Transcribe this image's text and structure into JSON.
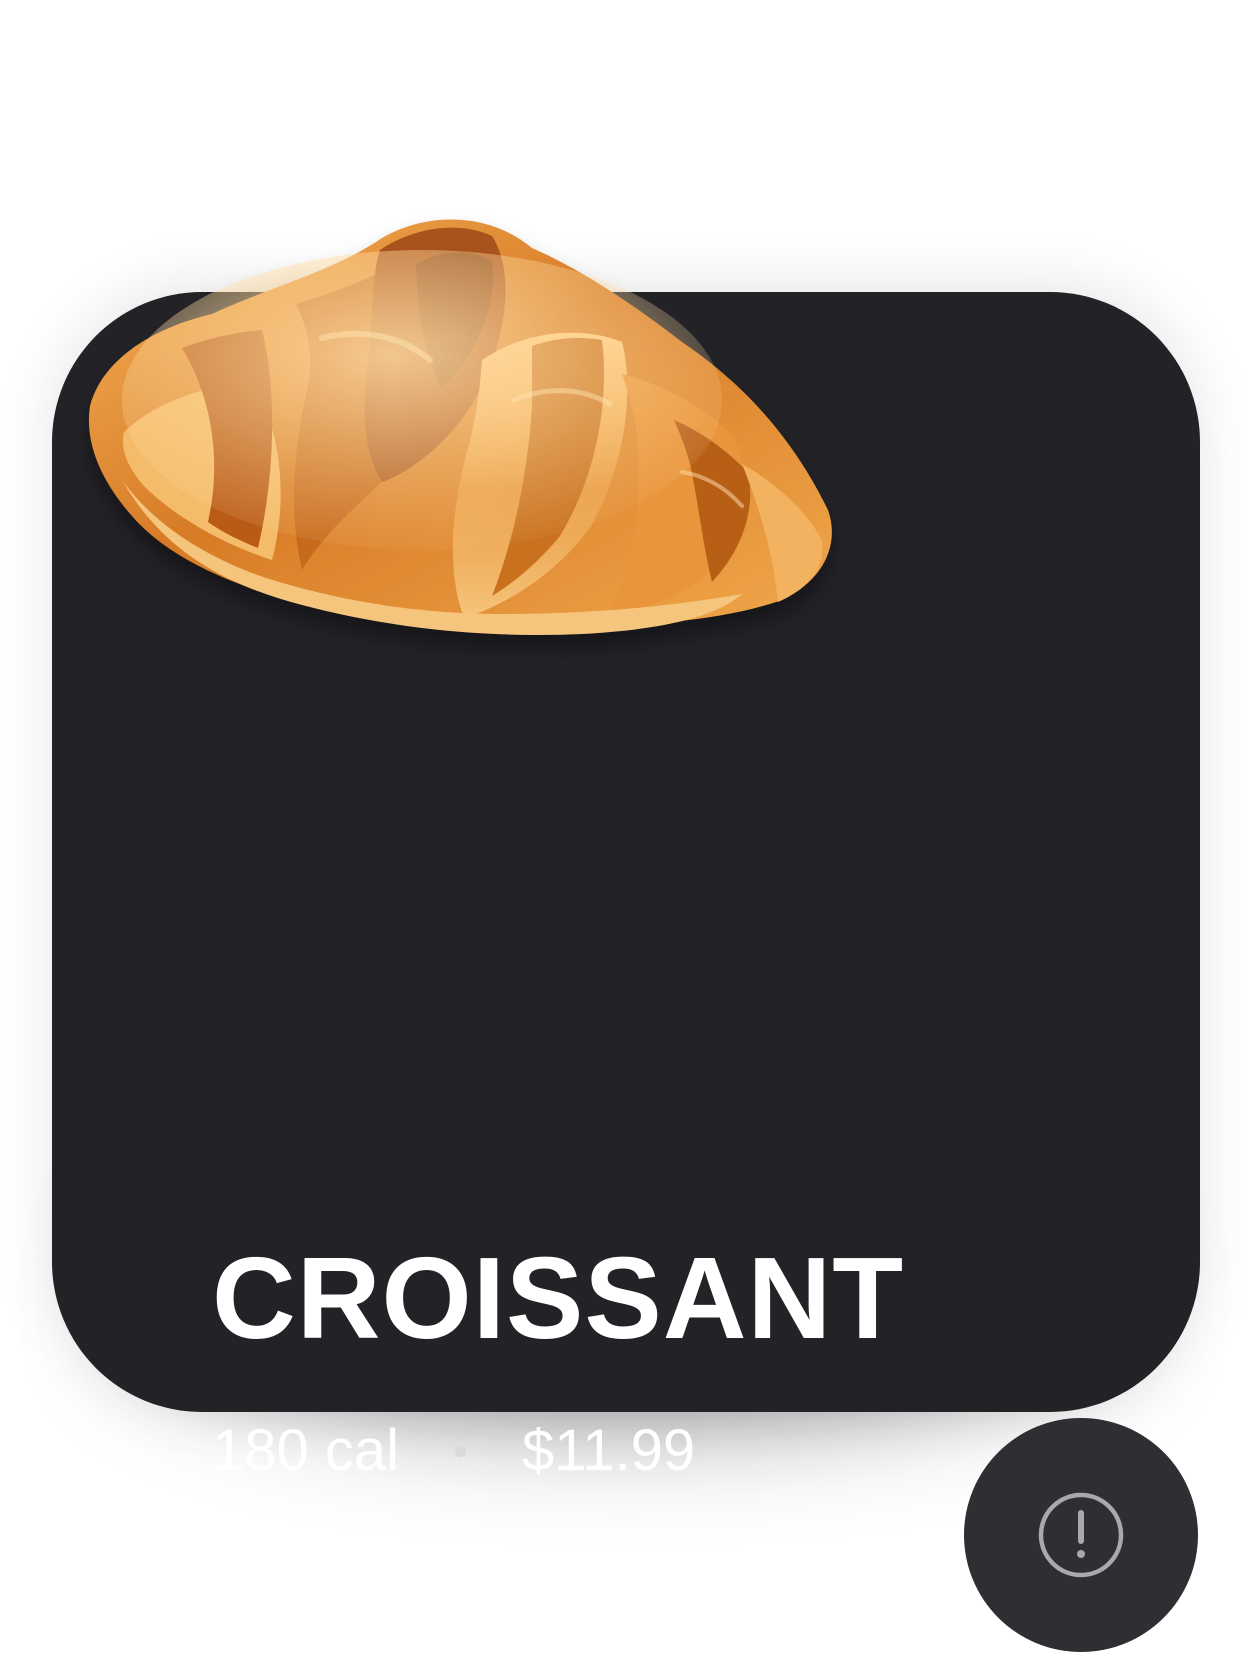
{
  "product": {
    "name": "CROISSANT",
    "calories": "180 cal",
    "separator": "•",
    "price": "$11.99",
    "image_icon": "croissant-image"
  },
  "actions": {
    "info_icon": "exclamation-circle-icon"
  },
  "colors": {
    "card_background": "#222227",
    "info_button_background": "#2e2e33",
    "text": "#ffffff",
    "icon_stroke": "#a8a8ad"
  }
}
